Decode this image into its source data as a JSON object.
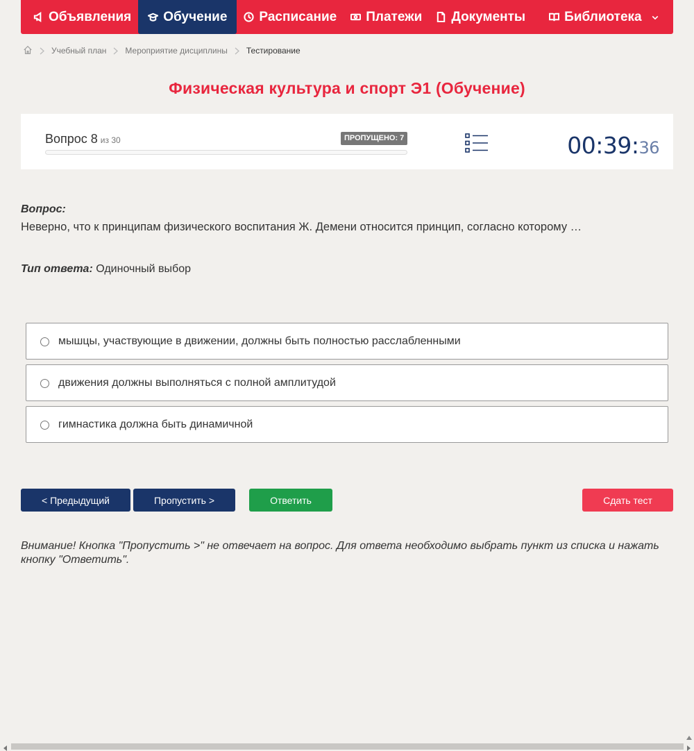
{
  "nav": {
    "items": [
      {
        "label": "Объявления",
        "icon": "megaphone-icon"
      },
      {
        "label": "Обучение",
        "icon": "graduation-cap-icon",
        "active": true
      },
      {
        "label": "Расписание",
        "icon": "clock-icon"
      },
      {
        "label": "Платежи",
        "icon": "money-icon"
      },
      {
        "label": "Документы",
        "icon": "document-icon"
      },
      {
        "label": "Библиотека",
        "icon": "book-icon"
      }
    ]
  },
  "breadcrumb": {
    "home_icon": "home-icon",
    "items": [
      "Учебный план",
      "Мероприятие дисциплины",
      "Тестирование"
    ]
  },
  "page": {
    "title": "Физическая культура и спорт Э1 (Обучение)"
  },
  "status": {
    "question_label": "Вопрос 8",
    "of_label": "из 30",
    "current": 8,
    "total": 30,
    "skipped_label": "ПРОПУЩЕНО: 7",
    "progress_fraction": 0.0,
    "timer_main": "00:39:",
    "timer_seconds": "36"
  },
  "question": {
    "label": "Вопрос:",
    "text": "Неверно, что к принципам физического воспитания Ж. Демени относится принцип, согласно которому …",
    "answer_type_label": "Тип ответа:",
    "answer_type_value": "Одиночный выбор"
  },
  "options": [
    "мышцы, участвующие в движении, должны быть полностью расслабленными",
    "движения должны выполняться с полной амплитудой",
    "гимнастика должна быть динамичной"
  ],
  "buttons": {
    "prev": "< Предыдущий",
    "skip": "Пропустить >",
    "answer": "Ответить",
    "submit": "Сдать тест"
  },
  "warning": "Внимание! Кнопка \"Пропустить >\" не отвечает на вопрос. Для ответа необходимо выбрать пункт из списка и нажать кнопку \"Ответить\".",
  "colors": {
    "brand_red": "#e8263e",
    "brand_navy": "#1a3569",
    "answer_green": "#1f9e4a",
    "submit_red": "#f03b52"
  }
}
